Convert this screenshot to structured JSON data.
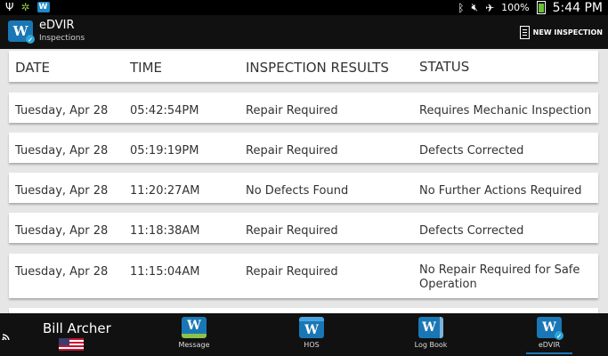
{
  "status_bar": {
    "notification_icons": [
      "usb-icon",
      "settings-icon",
      "app-badge-icon"
    ],
    "app_badge_letter": "W",
    "right_icons": [
      "bluetooth-icon",
      "mute-icon",
      "airplane-icon"
    ],
    "battery_text": "100%",
    "time": "5:44 PM"
  },
  "action_bar": {
    "app_icon_letter": "W",
    "title": "eDVIR",
    "subtitle": "Inspections",
    "new_inspection_label": "NEW INSPECTION"
  },
  "table": {
    "headers": [
      "DATE",
      "TIME",
      "INSPECTION RESULTS",
      "STATUS"
    ],
    "rows": [
      {
        "date": "Tuesday, Apr 28",
        "time": "05:42:54PM",
        "result": "Repair Required",
        "status": "Requires Mechanic Inspection"
      },
      {
        "date": "Tuesday, Apr 28",
        "time": "05:19:19PM",
        "result": "Repair Required",
        "status": "Defects Corrected"
      },
      {
        "date": "Tuesday, Apr 28",
        "time": "11:20:27AM",
        "result": "No Defects Found",
        "status": "No Further Actions Required"
      },
      {
        "date": "Tuesday, Apr 28",
        "time": "11:18:38AM",
        "result": "Repair Required",
        "status": "Defects Corrected"
      },
      {
        "date": "Tuesday, Apr 28",
        "time": "11:15:04AM",
        "result": "Repair Required",
        "status": "No Repair Required for Safe Operation"
      }
    ]
  },
  "bottom_nav": {
    "driver_name": "Bill Archer",
    "items": [
      {
        "label": "Message",
        "icon": "message-icon",
        "letter": "W"
      },
      {
        "label": "HOS",
        "icon": "hos-icon",
        "letter": "W"
      },
      {
        "label": "Log Book",
        "icon": "log-book-icon",
        "letter": "W"
      },
      {
        "label": "eDVIR",
        "icon": "edvir-icon",
        "letter": "W",
        "active": true
      }
    ]
  },
  "colors": {
    "brand_blue": "#1a77b5",
    "bar_background": "#111111",
    "list_background": "#e6e6e6"
  }
}
